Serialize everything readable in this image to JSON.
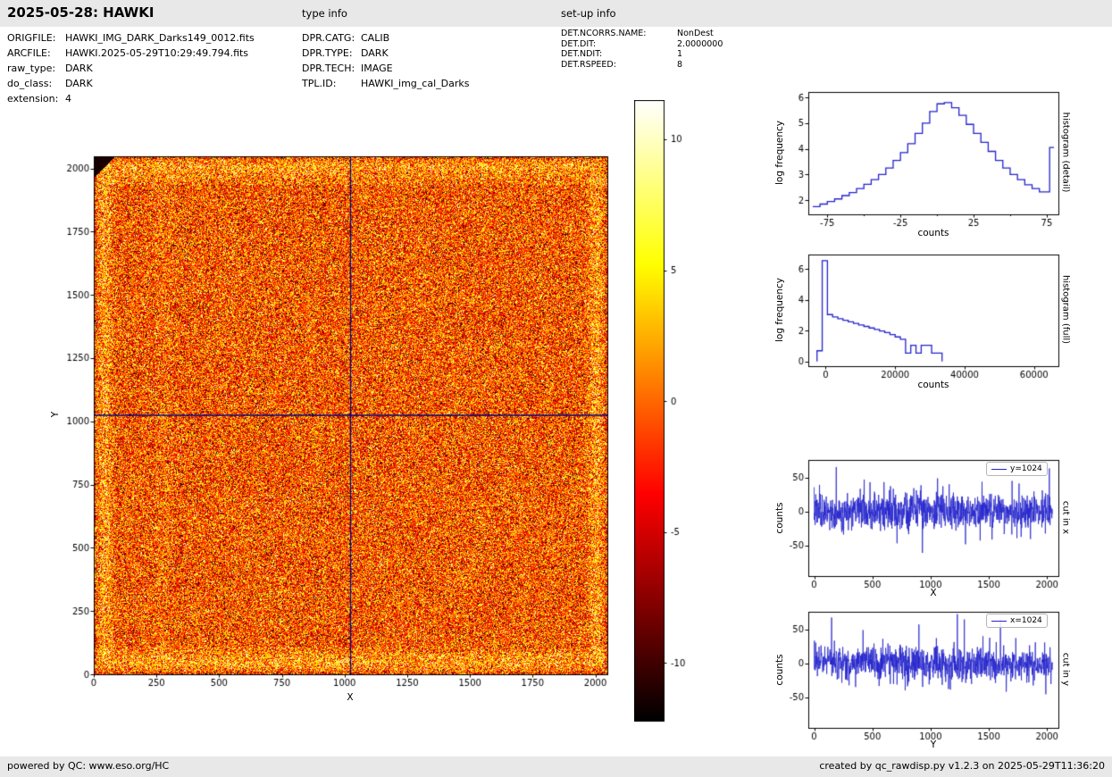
{
  "header": {
    "title": "2025-05-28: HAWKI",
    "type_info_label": "type info",
    "setup_info_label": "set-up info"
  },
  "file_info": [
    {
      "label": "ORIGFILE:",
      "value": "HAWKI_IMG_DARK_Darks149_0012.fits"
    },
    {
      "label": "ARCFILE:",
      "value": "HAWKI.2025-05-29T10:29:49.794.fits"
    },
    {
      "label": "raw_type:",
      "value": "DARK"
    },
    {
      "label": "do_class:",
      "value": "DARK"
    },
    {
      "label": "extension:",
      "value": "4"
    }
  ],
  "type_info": [
    {
      "label": "DPR.CATG:",
      "value": "CALIB"
    },
    {
      "label": "DPR.TYPE:",
      "value": "DARK"
    },
    {
      "label": "DPR.TECH:",
      "value": "IMAGE"
    },
    {
      "label": "TPL.ID:",
      "value": "HAWKI_img_cal_Darks"
    }
  ],
  "setup_info": [
    {
      "label": "DET.NCORRS.NAME:",
      "value": "NonDest"
    },
    {
      "label": "DET.DIT:",
      "value": "2.0000000"
    },
    {
      "label": "DET.NDIT:",
      "value": "1"
    },
    {
      "label": "DET.RSPEED:",
      "value": "8"
    }
  ],
  "footer": {
    "left": "powered by QC: www.eso.org/HC",
    "right": "created by qc_rawdisp.py v1.2.3 on 2025-05-29T11:36:20"
  },
  "chart_data": [
    {
      "id": "main_image",
      "type": "heatmap",
      "xlabel": "X",
      "ylabel": "Y",
      "xlim": [
        0,
        2048
      ],
      "ylim": [
        0,
        2048
      ],
      "x_ticks": [
        0,
        250,
        500,
        750,
        1000,
        1250,
        1500,
        1750,
        2000
      ],
      "y_ticks": [
        0,
        250,
        500,
        750,
        1000,
        1250,
        1500,
        1750,
        2000
      ],
      "colormap": "hot",
      "crosshair": {
        "x": 1024,
        "y": 1024
      },
      "crosshair_color": "#000080",
      "colorbar": {
        "vmin": -12.2,
        "vmax": 11.5,
        "ticks": [
          10,
          5,
          0,
          -5,
          -10
        ]
      }
    },
    {
      "id": "hist_detail",
      "type": "line",
      "style": "step-histogram",
      "side_label": "histogram (detail)",
      "xlabel": "counts",
      "ylabel": "log frequency",
      "color": "#2424cc",
      "xlim": [
        -88,
        83
      ],
      "ylim": [
        1.45,
        6.21
      ],
      "x_ticks": [
        -75,
        -25,
        25,
        75
      ],
      "x_minor_ticks": [
        -50,
        0,
        50
      ],
      "y_ticks": [
        2,
        3,
        4,
        5,
        6
      ],
      "baseline": false,
      "edges": [
        -85,
        -80,
        -75,
        -70,
        -65,
        -60,
        -55,
        -50,
        -45,
        -40,
        -35,
        -30,
        -25,
        -20,
        -15,
        -10,
        -5,
        0,
        5,
        10,
        15,
        20,
        25,
        30,
        35,
        40,
        45,
        50,
        55,
        60,
        65,
        70,
        77,
        80
      ],
      "values": [
        1.75,
        1.85,
        1.95,
        2.05,
        2.18,
        2.3,
        2.45,
        2.62,
        2.8,
        3.0,
        3.25,
        3.55,
        3.85,
        4.2,
        4.6,
        5.0,
        5.45,
        5.75,
        5.8,
        5.6,
        5.3,
        4.95,
        4.6,
        4.25,
        3.9,
        3.55,
        3.25,
        3.0,
        2.8,
        2.6,
        2.45,
        2.32,
        4.05
      ]
    },
    {
      "id": "hist_full",
      "type": "line",
      "style": "step-histogram",
      "side_label": "histogram (full)",
      "xlabel": "counts",
      "ylabel": "log frequency",
      "color": "#2424cc",
      "xlim": [
        -5000,
        67000
      ],
      "ylim": [
        -0.3,
        6.95
      ],
      "x_ticks": [
        0,
        20000,
        40000,
        60000
      ],
      "y_ticks": [
        0,
        2,
        4,
        6
      ],
      "baseline": true,
      "edges": [
        -2500,
        -1000,
        500,
        2000,
        3500,
        5000,
        6500,
        8000,
        9500,
        11000,
        12500,
        14000,
        15500,
        17000,
        18500,
        20000,
        21500,
        23000,
        24500,
        26000,
        27500,
        29000,
        30500,
        32000,
        33500
      ],
      "values": [
        0.7,
        6.55,
        3.05,
        2.9,
        2.78,
        2.68,
        2.58,
        2.48,
        2.38,
        2.28,
        2.18,
        2.08,
        1.98,
        1.88,
        1.75,
        1.6,
        1.45,
        0.55,
        1.05,
        0.55,
        1.05,
        1.05,
        0.55,
        0.55
      ]
    },
    {
      "id": "cut_x",
      "type": "line",
      "side_label": "cut in x",
      "legend": "y=1024",
      "xlabel": "X",
      "ylabel": "counts",
      "color": "#2424cc",
      "xlim": [
        -50,
        2098
      ],
      "ylim": [
        -95,
        76
      ],
      "x_ticks": [
        0,
        500,
        1000,
        1500,
        2000
      ],
      "y_ticks": [
        -50,
        0,
        50
      ],
      "noise": {
        "mean": 0,
        "std": 13,
        "n": 2048,
        "seed": 7
      },
      "spikes": [
        [
          190,
          70
        ],
        [
          430,
          55
        ],
        [
          480,
          44
        ],
        [
          600,
          36
        ],
        [
          830,
          40
        ],
        [
          930,
          -62
        ],
        [
          1060,
          42
        ],
        [
          1300,
          -45
        ],
        [
          1700,
          50
        ],
        [
          1760,
          44
        ],
        [
          2020,
          38
        ]
      ]
    },
    {
      "id": "cut_y",
      "type": "line",
      "side_label": "cut in y",
      "legend": "x=1024",
      "xlabel": "Y",
      "ylabel": "counts",
      "color": "#2424cc",
      "xlim": [
        -50,
        2098
      ],
      "ylim": [
        -95,
        76
      ],
      "x_ticks": [
        0,
        500,
        1000,
        1500,
        2000
      ],
      "y_ticks": [
        -50,
        0,
        50
      ],
      "noise": {
        "mean": 0,
        "std": 13,
        "n": 2048,
        "seed": 13
      },
      "spikes": [
        [
          150,
          34
        ],
        [
          300,
          -54
        ],
        [
          420,
          44
        ],
        [
          650,
          40
        ],
        [
          900,
          46
        ],
        [
          1050,
          46
        ],
        [
          1230,
          74
        ],
        [
          1290,
          66
        ],
        [
          1450,
          40
        ],
        [
          1600,
          54
        ],
        [
          1850,
          44
        ],
        [
          1990,
          -50
        ]
      ]
    }
  ]
}
